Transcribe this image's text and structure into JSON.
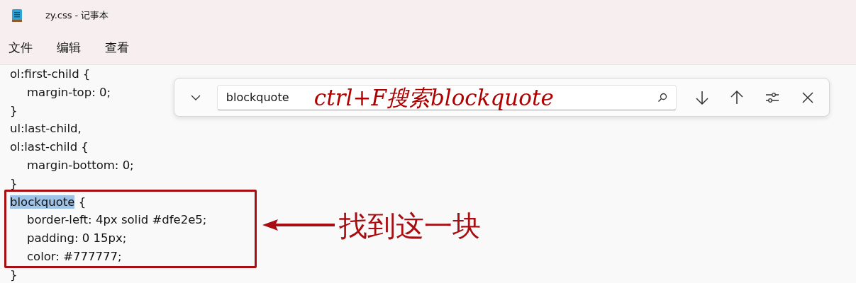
{
  "window": {
    "title": "zy.css - 记事本"
  },
  "menu": [
    {
      "label": "文件"
    },
    {
      "label": "编辑"
    },
    {
      "label": "查看"
    }
  ],
  "editor": {
    "lines": [
      {
        "kind": "top",
        "text": "ol:first-child {"
      },
      {
        "kind": "indented",
        "text": "margin-top: 0;"
      },
      {
        "kind": "top",
        "text": "}"
      },
      {
        "kind": "top",
        "text": "ul:last-child,"
      },
      {
        "kind": "top",
        "text": "ol:last-child {"
      },
      {
        "kind": "indented",
        "text": "margin-bottom: 0;"
      },
      {
        "kind": "top",
        "text": "}"
      },
      {
        "kind": "top",
        "match": "blockquote",
        "text": " {"
      },
      {
        "kind": "indented",
        "text": "border-left: 4px solid #dfe2e5;"
      },
      {
        "kind": "indented",
        "text": "padding: 0 15px;"
      },
      {
        "kind": "indented",
        "text": "color: #777777;"
      },
      {
        "kind": "top",
        "text": "}"
      }
    ]
  },
  "find_bar": {
    "value": "blockquote"
  },
  "annotations": {
    "find_note": "ctrl+F搜索blockquote",
    "callout": "找到这一块"
  }
}
